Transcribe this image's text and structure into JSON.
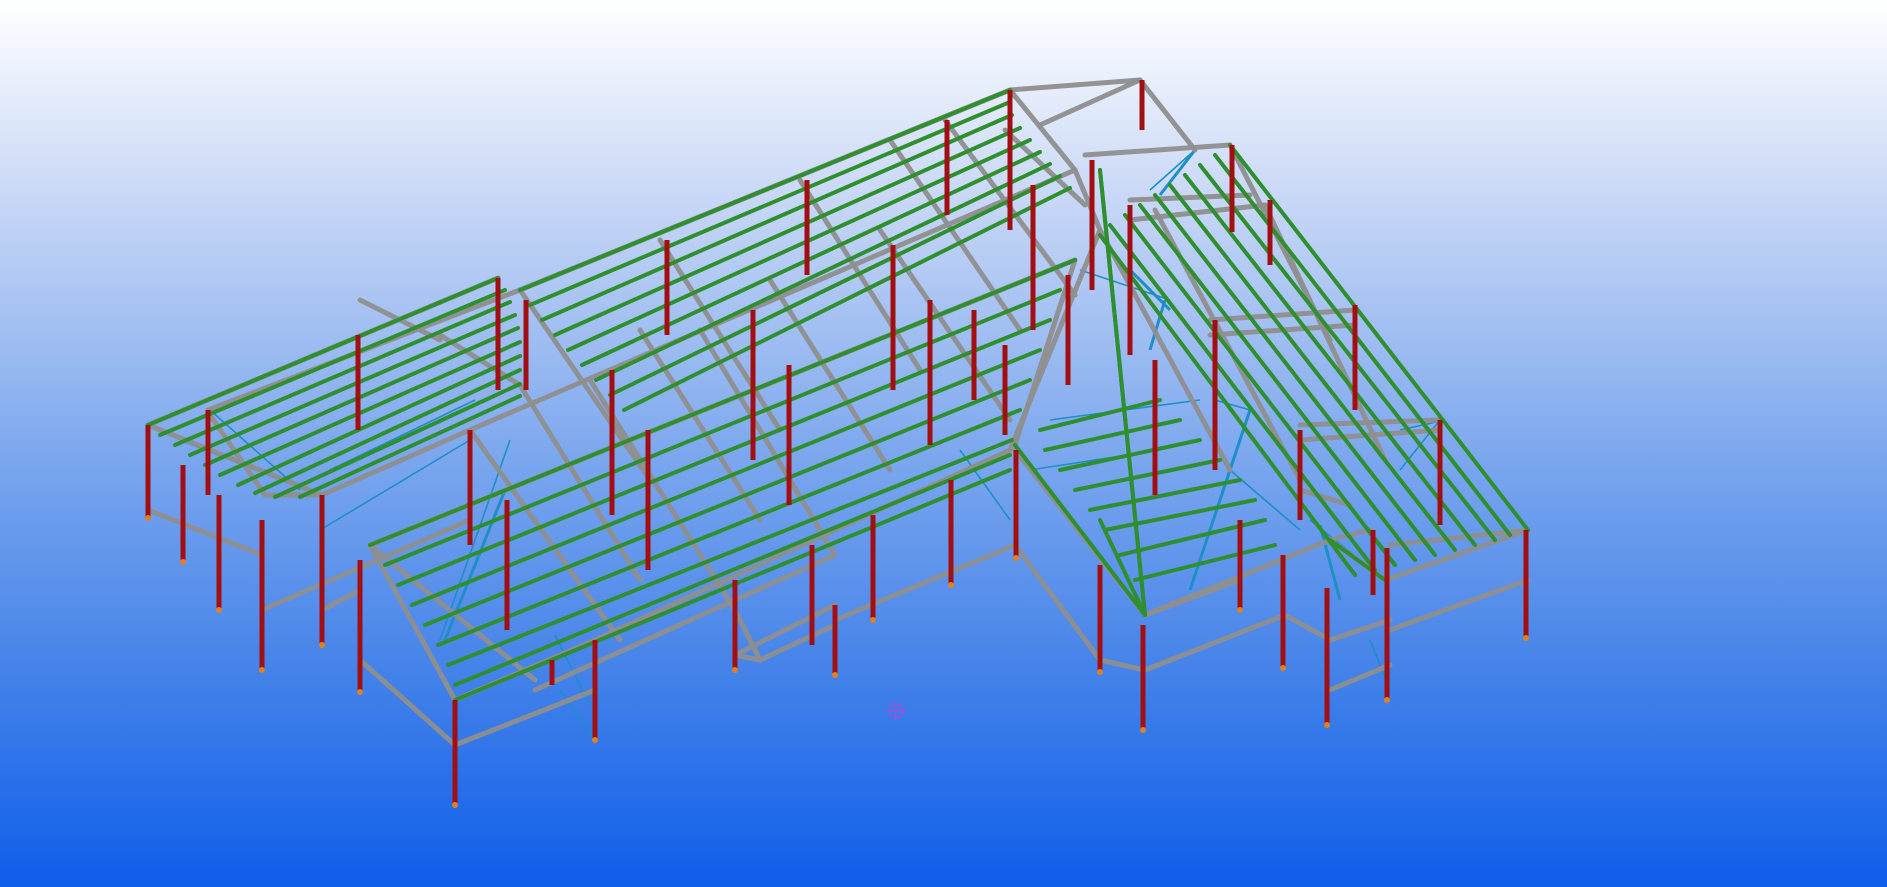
{
  "viewport": {
    "background_top": "#ffffff",
    "background_bottom": "#0f5eea"
  },
  "colors": {
    "column": "#a10f12",
    "beam": "#8f8f8f",
    "purlin": "#2f8f2f",
    "bracing": "#1e8fc6",
    "orbit_marker": "#c040d8"
  },
  "icons": {
    "orbit_center": "crosshair-circle-icon"
  }
}
